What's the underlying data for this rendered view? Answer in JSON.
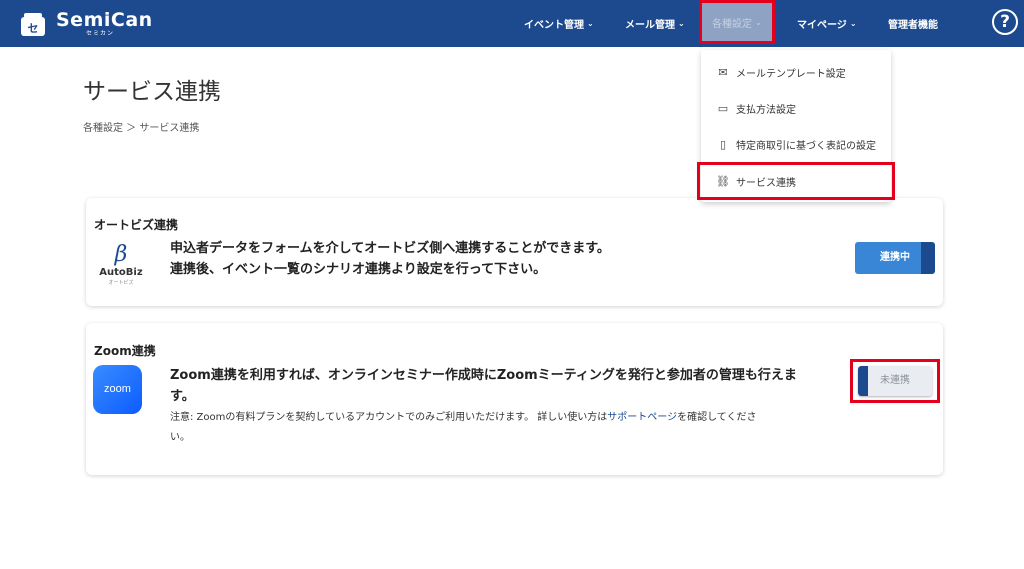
{
  "header": {
    "logo_text": "SemiCan",
    "logo_sub": "セミカン",
    "nav": [
      {
        "label": "イベント管理"
      },
      {
        "label": "メール管理"
      },
      {
        "label": "各種設定"
      },
      {
        "label": "マイページ"
      },
      {
        "label": "管理者機能"
      }
    ],
    "help": "?"
  },
  "page": {
    "title": "サービス連携",
    "breadcrumb": "各種設定 ＞ サービス連携"
  },
  "dropdown": {
    "items": [
      {
        "label": "メールテンプレート設定",
        "icon": "mail-icon"
      },
      {
        "label": "支払方法設定",
        "icon": "card-icon"
      },
      {
        "label": "特定商取引に基づく表記の設定",
        "icon": "document-icon"
      },
      {
        "label": "サービス連携",
        "icon": "link-icon"
      }
    ]
  },
  "autobiz": {
    "title": "オートビズ連携",
    "logo_word": "AutoBiz",
    "logo_sub": "オートビズ",
    "line1": "申込者データをフォームを介してオートビズ側へ連携することができます。",
    "line2": "連携後、イベント一覧のシナリオ連携より設定を行って下さい。",
    "button": "連携中"
  },
  "zoom": {
    "title": "Zoom連携",
    "logo": "zoom",
    "line1": "Zoom連携を利用すれば、オンラインセミナー作成時にZoomミーティングを発行と参加者の管理も行えま",
    "line2": "す。",
    "note_pre": "注意: Zoomの有料プランを契約しているアカウントでのみご利用いただけます。 詳しい使い方は",
    "note_link": "サポートページ",
    "note_post": "を確認してくださ",
    "note_line2": "い。",
    "button": "未連携"
  },
  "colors": {
    "header": "#1d4a8f",
    "highlight": "#e4001c",
    "button_blue": "#3a86d6"
  }
}
